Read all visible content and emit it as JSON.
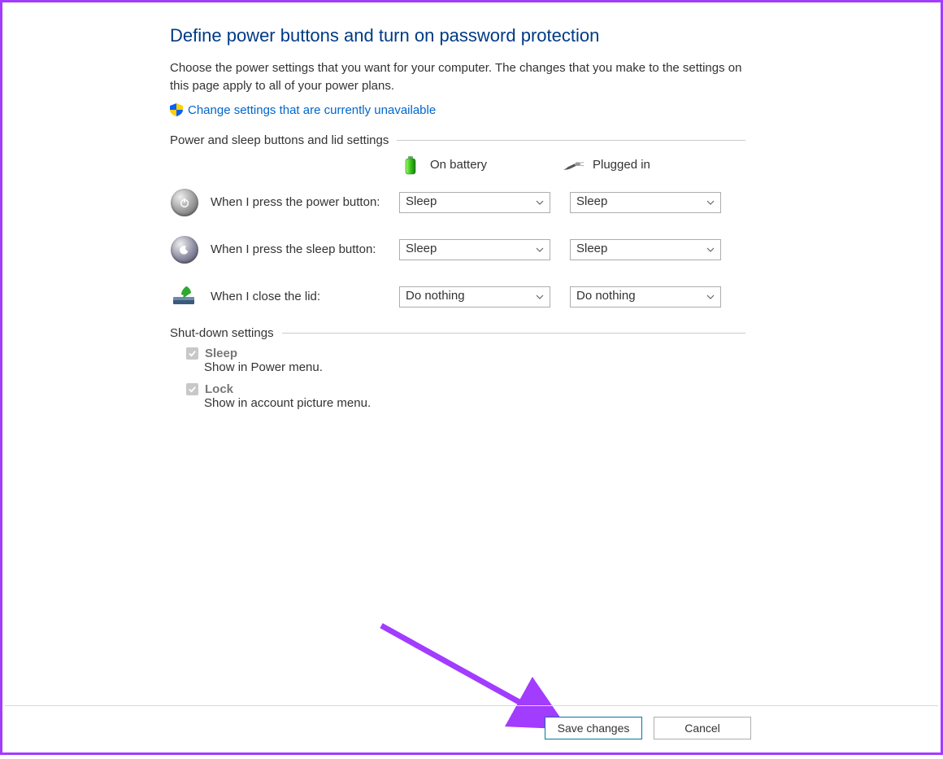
{
  "header": {
    "title": "Define power buttons and turn on password protection",
    "description": "Choose the power settings that you want for your computer. The changes that you make to the settings on this page apply to all of your power plans.",
    "changeSettingsLink": "Change settings that are currently unavailable"
  },
  "sections": {
    "powerSleep": {
      "title": "Power and sleep buttons and lid settings",
      "columns": {
        "battery": "On battery",
        "pluggedIn": "Plugged in"
      },
      "rows": {
        "power": {
          "label": "When I press the power button:",
          "batteryValue": "Sleep",
          "pluggedValue": "Sleep"
        },
        "sleep": {
          "label": "When I press the sleep button:",
          "batteryValue": "Sleep",
          "pluggedValue": "Sleep"
        },
        "lid": {
          "label": "When I close the lid:",
          "batteryValue": "Do nothing",
          "pluggedValue": "Do nothing"
        }
      }
    },
    "shutdown": {
      "title": "Shut-down settings",
      "items": {
        "sleep": {
          "label": "Sleep",
          "sub": "Show in Power menu."
        },
        "lock": {
          "label": "Lock",
          "sub": "Show in account picture menu."
        }
      }
    }
  },
  "footer": {
    "save": "Save changes",
    "cancel": "Cancel"
  }
}
